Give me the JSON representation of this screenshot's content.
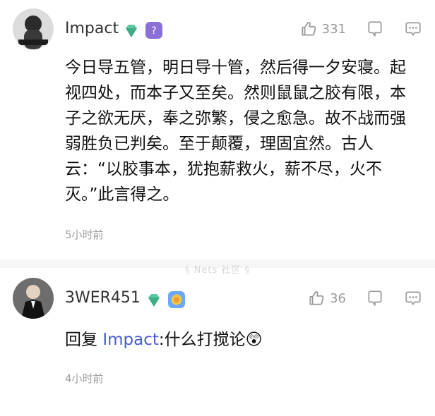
{
  "comments": [
    {
      "username": "Impact",
      "likes": "331",
      "text": "今日导五管，明日导十管，然后得一夕安寝。起视四处，而本子又至矣。然则鼠鼠之胶有限，本子之欲无厌，奉之弥繁，侵之愈急。故不战而强弱胜负已判矣。至于颠覆，理固宜然。古人云：“以胶事本，犹抱薪救火，薪不尽，火不灭。”此言得之。",
      "time": "5小时前"
    },
    {
      "username": "3WER451",
      "likes": "36",
      "reply_prefix": "回复",
      "mention": "Impact",
      "reply_body": ":什么打搅论",
      "emoji": "😲",
      "time": "4小时前"
    }
  ],
  "watermark": "§ Nets 社区 §",
  "colors": {
    "mention": "#4a5bd0",
    "badge_diamond": "#5cc8a0",
    "badge_level": "#8a6fd6"
  },
  "icons": [
    "thumbs-up-icon",
    "reply-icon",
    "more-icon",
    "diamond-badge-icon",
    "level-badge-icon",
    "achievement-badge-icon"
  ]
}
